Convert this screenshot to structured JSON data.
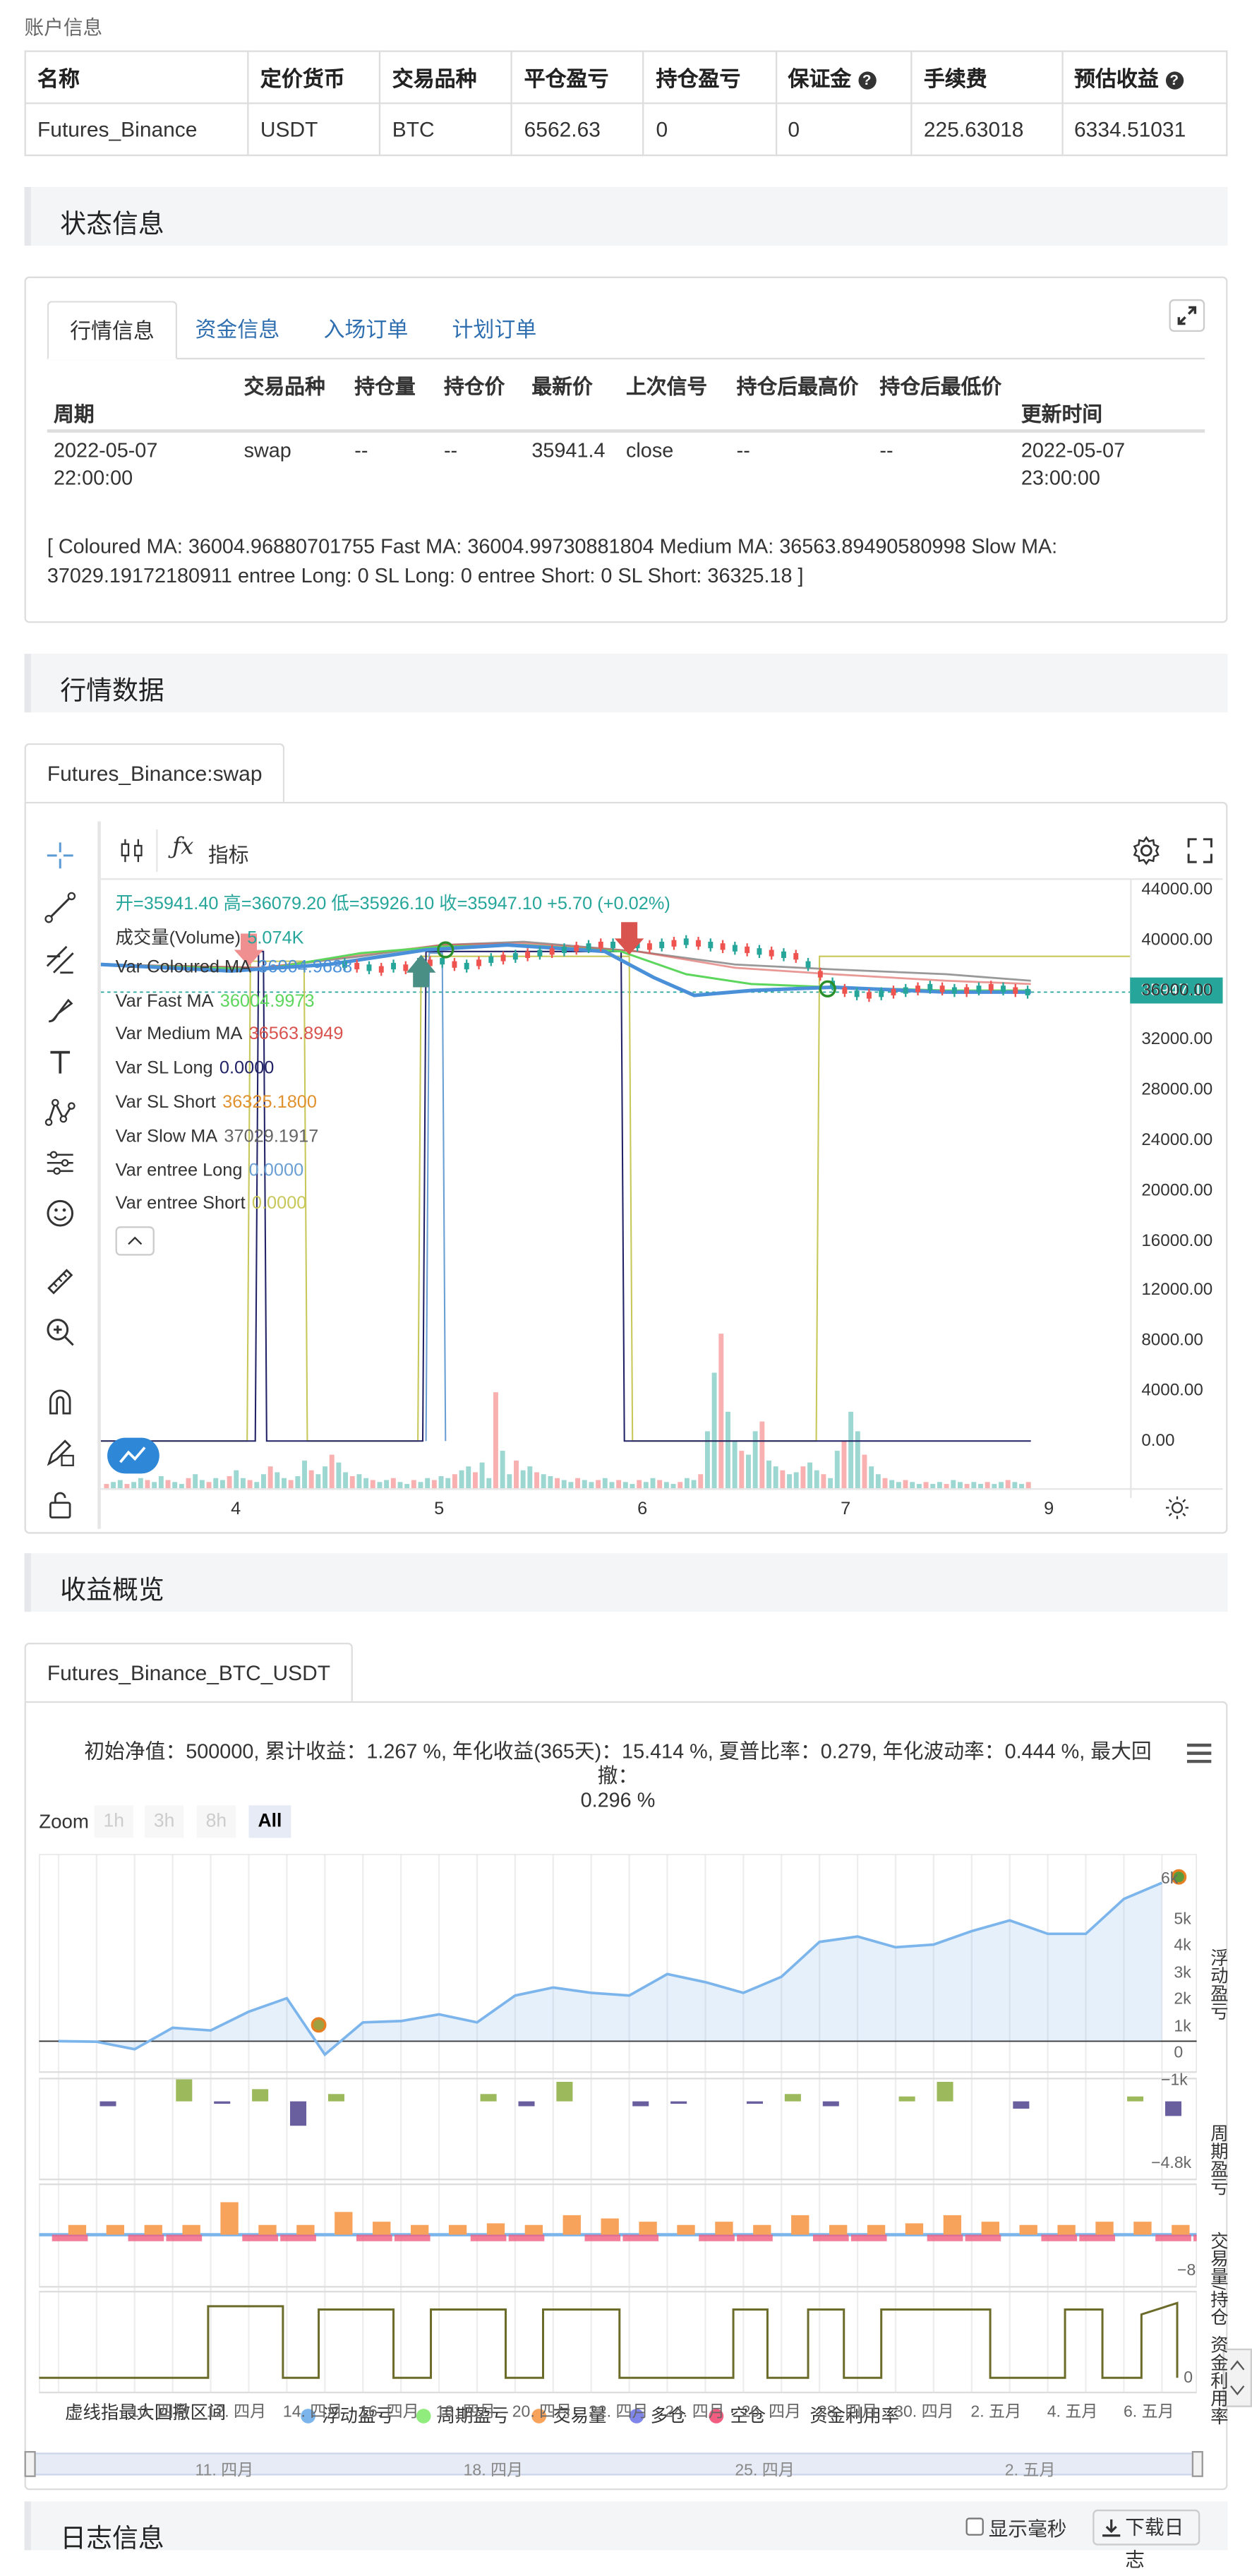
{
  "account": {
    "title": "账户信息",
    "headers": [
      "名称",
      "定价货币",
      "交易品种",
      "平仓盈亏",
      "持仓盈亏",
      "保证金",
      "手续费",
      "预估收益"
    ],
    "row": [
      "Futures_Binance",
      "USDT",
      "BTC",
      "6562.63",
      "0",
      "0",
      "225.63018",
      "6334.51031"
    ]
  },
  "status": {
    "title": "状态信息",
    "tabs": [
      "行情信息",
      "资金信息",
      "入场订单",
      "计划订单"
    ],
    "columns": [
      "周期",
      "交易品种",
      "持仓量",
      "持仓价",
      "最新价",
      "上次信号",
      "持仓后最高价",
      "持仓后最低价",
      "更新时间"
    ],
    "row": {
      "period_1": "2022-05-07",
      "period_2": "22:00:00",
      "symbol": "swap",
      "qty": "--",
      "price": "--",
      "last": "35941.4",
      "signal": "close",
      "high": "--",
      "low": "--",
      "updated_1": "2022-05-07",
      "updated_2": "23:00:00"
    },
    "log": "[ Coloured MA: 36004.96880701755 Fast MA: 36004.99730881804 Medium MA: 36563.89490580998 Slow MA: 37029.19172180911 entree Long: 0 SL Long: 0 entree Short: 0 SL Short: 36325.18 ]"
  },
  "market": {
    "title": "行情数据",
    "tab": "Futures_Binance:swap",
    "indicator_label": "指标",
    "ohlc": "开=35941.40 高=36079.20 低=35926.10 收=35947.10 +5.70 (+0.02%)",
    "legend": [
      {
        "label": "成交量(Volume)",
        "value": "5.074K",
        "color": "#26a69a"
      },
      {
        "label": "Var Coloured MA",
        "value": "36004.9688",
        "color": "#4a90d9"
      },
      {
        "label": "Var Fast MA",
        "value": "36004.9973",
        "color": "#5cd65c"
      },
      {
        "label": "Var Medium MA",
        "value": "36563.8949",
        "color": "#d9534f"
      },
      {
        "label": "Var SL Long",
        "value": "0.0000",
        "color": "#222266"
      },
      {
        "label": "Var SL Short",
        "value": "36325.1800",
        "color": "#e0922f"
      },
      {
        "label": "Var Slow MA",
        "value": "37029.1917",
        "color": "#666666"
      },
      {
        "label": "Var entree Long",
        "value": "0.0000",
        "color": "#6a9fd4"
      },
      {
        "label": "Var entree Short",
        "value": "0.0000",
        "color": "#c8c85a"
      }
    ],
    "y_ticks": [
      "44000.00",
      "40000.00",
      "36000.00",
      "32000.00",
      "28000.00",
      "24000.00",
      "20000.00",
      "16000.00",
      "12000.00",
      "8000.00",
      "4000.00",
      "0.00"
    ],
    "price_tag": "35947.10",
    "x_ticks": [
      "4",
      "5",
      "6",
      "7",
      "9"
    ],
    "colors": {
      "up": "#26a69a",
      "down": "#ef5350"
    }
  },
  "profit": {
    "title": "收益概览",
    "tab": "Futures_Binance_BTC_USDT",
    "summary_1": "初始净值：500000, 累计收益：1.267 %, 年化收益(365天)：15.414 %, 夏普比率：0.279, 年化波动率：0.444 %, 最大回撤：",
    "summary_2": "0.296 %",
    "zoom_label": "Zoom",
    "zoom_buttons": [
      "1h",
      "3h",
      "8h",
      "All"
    ],
    "pane_labels": [
      "浮动盈亏",
      "周期盈亏",
      "交易量/持仓",
      "资金利用率"
    ],
    "y1_ticks": [
      "6k",
      "5k",
      "4k",
      "3k",
      "2k",
      "1k",
      "0",
      "−1k"
    ],
    "y2_tick": "−4.8k",
    "y3_tick": "−8",
    "y4_tick": "0",
    "x_ticks": [
      "10. 四月",
      "12. 四月",
      "14. 四月",
      "16. 四月",
      "18. 四月",
      "20. 四月",
      "22. 四月",
      "24. 四月",
      "26. 四月",
      "28. 四月",
      "30. 四月",
      "2. 五月",
      "4. 五月",
      "6. 五月"
    ],
    "legend": [
      {
        "label": "浮动盈亏",
        "color": "#7cb5ec"
      },
      {
        "label": "周期盈亏",
        "color": "#90ed7d"
      },
      {
        "label": "交易量",
        "color": "#f7a35c"
      },
      {
        "label": "多仓",
        "color": "#8085e9"
      },
      {
        "label": "空仓",
        "color": "#f15c80"
      },
      {
        "label": "资金利用率",
        "color": "#555"
      }
    ],
    "legend_overlap": "虚线指最大回撤区间",
    "navigator_ticks": [
      "11. 四月",
      "18. 四月",
      "25. 四月",
      "2. 五月"
    ],
    "float_pnl": [
      0,
      -20,
      -300,
      500,
      400,
      1100,
      1600,
      -500,
      700,
      750,
      1000,
      700,
      1700,
      2000,
      1800,
      1700,
      2500,
      2200,
      1800,
      2400,
      3700,
      3900,
      3500,
      3600,
      4100,
      4500,
      4000,
      4000,
      5300,
      5900
    ]
  },
  "log": {
    "title": "日志信息",
    "ms_label": "显示毫秒",
    "download_label": "下载日志"
  }
}
